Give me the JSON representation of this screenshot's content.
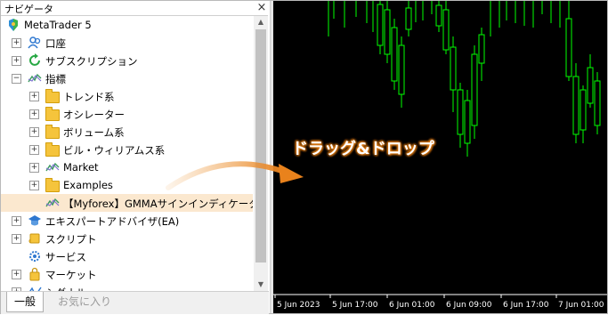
{
  "navigator": {
    "title": "ナビゲータ",
    "close_glyph": "×",
    "items": [
      {
        "label": "MetaTrader 5",
        "icon": "metatrader-logo-icon",
        "level": 0,
        "expander": ""
      },
      {
        "label": "口座",
        "icon": "accounts-icon",
        "level": 1,
        "expander": "+"
      },
      {
        "label": "サブスクリプション",
        "icon": "subscriptions-icon",
        "level": 1,
        "expander": "+"
      },
      {
        "label": "指標",
        "icon": "indicator-icon",
        "level": 1,
        "expander": "−"
      },
      {
        "label": "トレンド系",
        "icon": "folder-icon",
        "level": 2,
        "expander": "+"
      },
      {
        "label": "オシレーター",
        "icon": "folder-icon",
        "level": 2,
        "expander": "+"
      },
      {
        "label": "ボリューム系",
        "icon": "folder-icon",
        "level": 2,
        "expander": "+"
      },
      {
        "label": "ビル・ウィリアムス系",
        "icon": "folder-icon",
        "level": 2,
        "expander": "+"
      },
      {
        "label": "Market",
        "icon": "indicator-icon",
        "level": 2,
        "expander": "+"
      },
      {
        "label": "Examples",
        "icon": "folder-icon",
        "level": 2,
        "expander": "+"
      },
      {
        "label": "【Myforex】GMMAサインインディケータ",
        "icon": "indicator-icon",
        "level": 2,
        "expander": "",
        "selected": true
      },
      {
        "label": "エキスパートアドバイザ(EA)",
        "icon": "expert-advisor-icon",
        "level": 1,
        "expander": "+"
      },
      {
        "label": "スクリプト",
        "icon": "script-icon",
        "level": 1,
        "expander": "+"
      },
      {
        "label": "サービス",
        "icon": "services-icon",
        "level": 1,
        "expander": ""
      },
      {
        "label": "マーケット",
        "icon": "market-bag-icon",
        "level": 1,
        "expander": "+"
      },
      {
        "label": "シグナル",
        "icon": "signals-icon",
        "level": 1,
        "expander": "+"
      }
    ]
  },
  "tabs": [
    {
      "label": "一般",
      "active": true
    },
    {
      "label": "お気に入り",
      "active": false
    }
  ],
  "annotation": {
    "text": "ドラッグ&ドロップ",
    "color": "#e9821c"
  },
  "chart": {
    "background": "#000000",
    "candle_color": "#00ff00",
    "x_labels": [
      "5 Jun 2023",
      "5 Jun 17:00",
      "6 Jun 01:00",
      "6 Jun 09:00",
      "6 Jun 17:00",
      "7 Jun 01:00"
    ]
  }
}
